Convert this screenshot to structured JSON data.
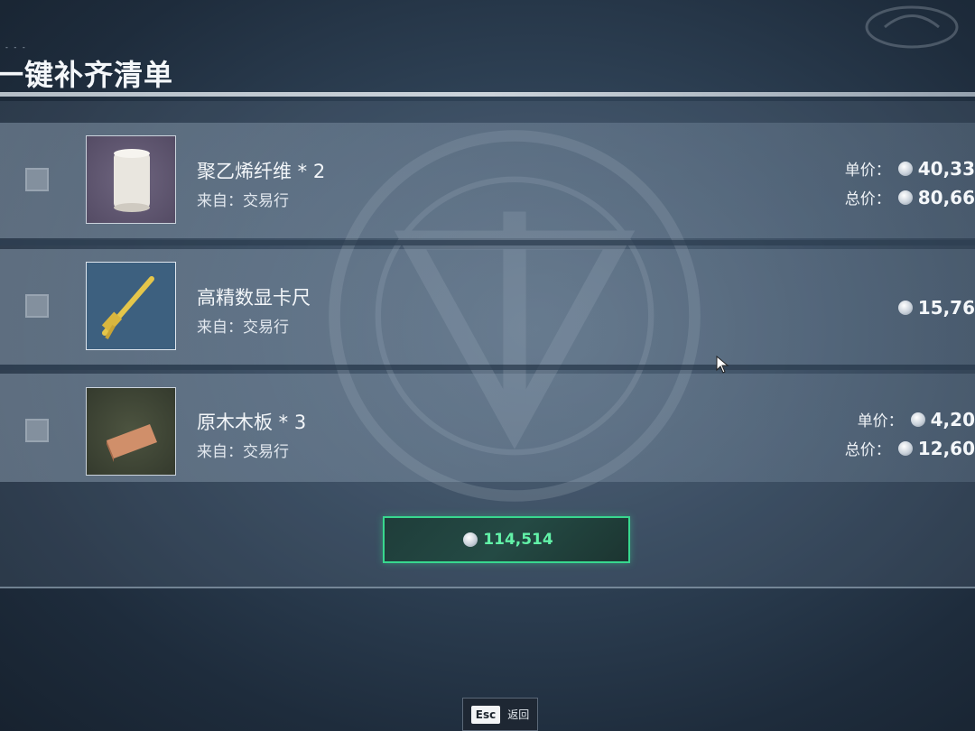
{
  "header": {
    "tiny_text": "- - -",
    "title": "一键补齐清单"
  },
  "items": [
    {
      "name": "聚乙烯纤维 * 2",
      "source": "来自：交易行",
      "unit_label": "单价：",
      "unit_price": "40,33",
      "total_label": "总价：",
      "total_price": "80,66",
      "icon": "fiber-roll-icon"
    },
    {
      "name": "高精数显卡尺",
      "source": "来自：交易行",
      "price": "15,76",
      "icon": "caliper-icon"
    },
    {
      "name": "原木木板 * 3",
      "source": "来自：交易行",
      "unit_label": "单价：",
      "unit_price": "4,20",
      "total_label": "总价：",
      "total_price": "12,60",
      "icon": "wood-plank-icon"
    }
  ],
  "summary": {
    "total": "114,514"
  },
  "footer": {
    "esc_key": "Esc",
    "esc_label": "返回"
  },
  "colors": {
    "accent_green": "#38d88f",
    "total_text": "#62f2a8"
  }
}
